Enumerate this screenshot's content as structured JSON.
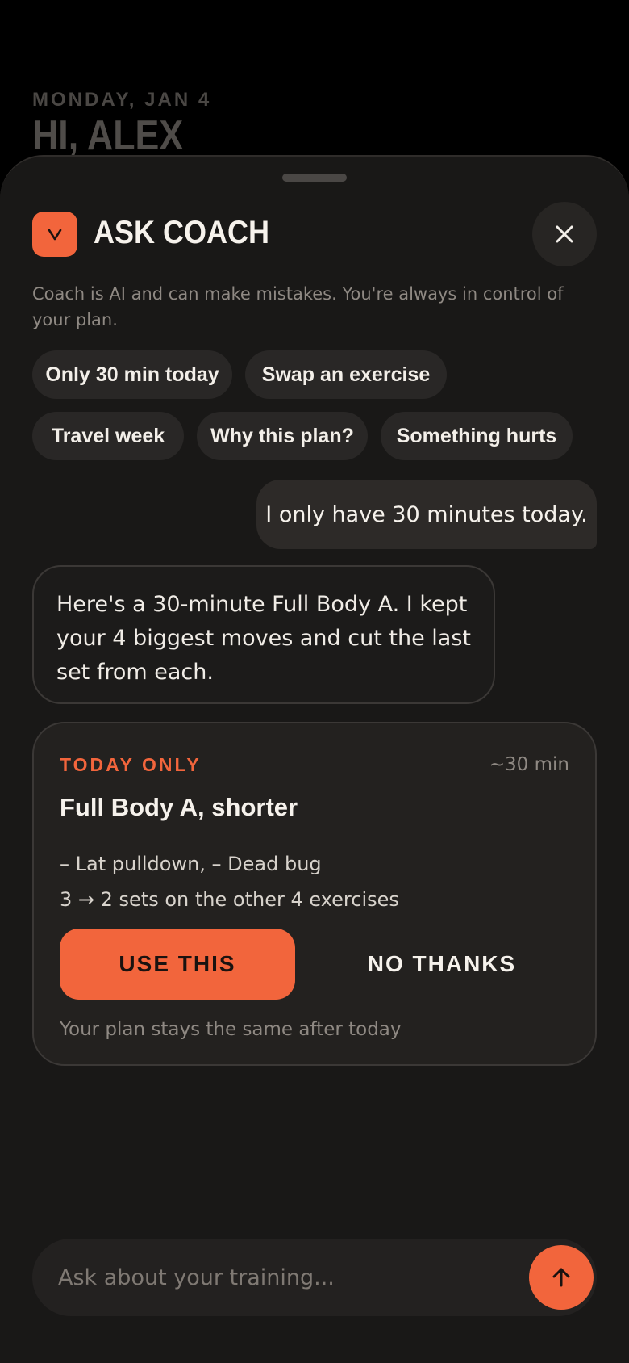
{
  "background": {
    "date": "MONDAY, JAN 4",
    "greeting": "HI, ALEX"
  },
  "sheet": {
    "title": "ASK COACH",
    "disclaimer": "Coach is AI and can make mistakes. You're always in control of your plan.",
    "close_icon": "close-icon",
    "logo_icon": "chevron-down-icon"
  },
  "suggestions": [
    "Only 30 min today",
    "Swap an exercise",
    "Travel week",
    "Why this plan?",
    "Something hurts"
  ],
  "messages": {
    "user": "I only have 30 minutes today.",
    "coach": "Here's a 30-minute Full Body A. I kept your 4 biggest moves and cut the last set from each."
  },
  "proposal": {
    "tag": "TODAY ONLY",
    "duration": "~30 min",
    "title": "Full Body A, shorter",
    "changes": [
      "– Lat pulldown, – Dead bug",
      "3 → 2 sets on the other 4 exercises"
    ],
    "accept_label": "USE THIS",
    "decline_label": "NO THANKS",
    "note": "Your plan stays the same after today"
  },
  "composer": {
    "placeholder": "Ask about your training...",
    "send_icon": "arrow-up-icon"
  },
  "colors": {
    "accent": "#f2653c",
    "sheet": "#191817",
    "card": "#23211f"
  }
}
